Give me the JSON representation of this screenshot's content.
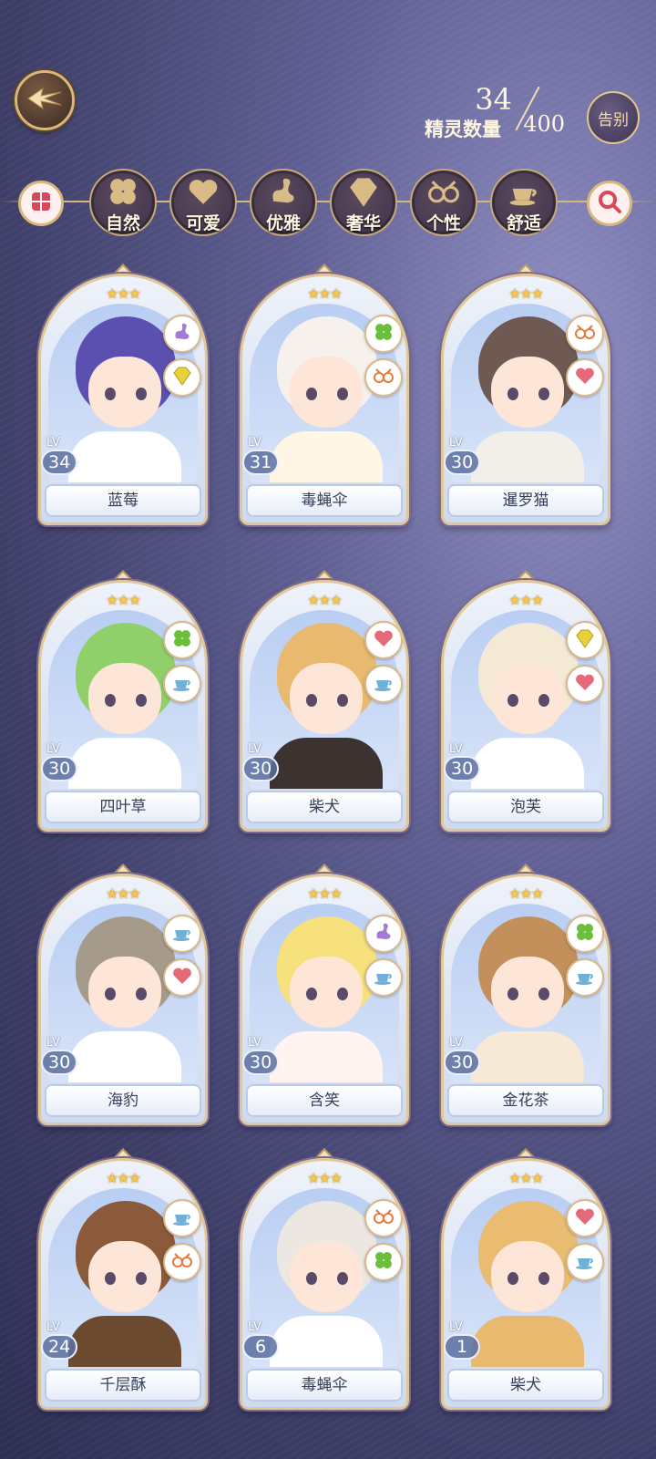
{
  "header": {
    "spirit_count_label": "精灵数量",
    "spirit_count_current": "34",
    "spirit_count_total": "400",
    "farewell_label": "告别"
  },
  "filters": [
    {
      "label": "自然",
      "icon": "clover-icon"
    },
    {
      "label": "可爱",
      "icon": "heart-icon"
    },
    {
      "label": "优雅",
      "icon": "swan-icon"
    },
    {
      "label": "奢华",
      "icon": "diamond-icon"
    },
    {
      "label": "个性",
      "icon": "glasses-icon"
    },
    {
      "label": "舒适",
      "icon": "teacup-icon"
    }
  ],
  "cards": [
    {
      "name": "蓝莓",
      "lv_tag": "LV",
      "level": "34",
      "stars": "★★★",
      "traits": [
        "swan-icon",
        "diamond-icon"
      ],
      "hair": "#5b4fb0",
      "outfit": "#ffffff"
    },
    {
      "name": "毒蝇伞",
      "lv_tag": "LV",
      "level": "31",
      "stars": "★★★",
      "traits": [
        "clover-icon",
        "glasses-icon"
      ],
      "hair": "#f6f1ec",
      "outfit": "#fff6e5"
    },
    {
      "name": "暹罗猫",
      "lv_tag": "LV",
      "level": "30",
      "stars": "★★★",
      "traits": [
        "glasses-icon",
        "heart-icon"
      ],
      "hair": "#6e5a52",
      "outfit": "#f2eee8"
    },
    {
      "name": "四叶草",
      "lv_tag": "LV",
      "level": "30",
      "stars": "★★★",
      "traits": [
        "clover-icon",
        "teacup-icon"
      ],
      "hair": "#8fd06a",
      "outfit": "#ffffff"
    },
    {
      "name": "柴犬",
      "lv_tag": "LV",
      "level": "30",
      "stars": "★★★",
      "traits": [
        "heart-icon",
        "teacup-icon"
      ],
      "hair": "#e8b96e",
      "outfit": "#3c3330"
    },
    {
      "name": "泡芙",
      "lv_tag": "LV",
      "level": "30",
      "stars": "★★★",
      "traits": [
        "diamond-icon",
        "heart-icon"
      ],
      "hair": "#f4e9d4",
      "outfit": "#ffffff"
    },
    {
      "name": "海豹",
      "lv_tag": "LV",
      "level": "30",
      "stars": "★★★",
      "traits": [
        "teacup-icon",
        "heart-icon"
      ],
      "hair": "#a69a8a",
      "outfit": "#ffffff"
    },
    {
      "name": "含笑",
      "lv_tag": "LV",
      "level": "30",
      "stars": "★★★",
      "traits": [
        "swan-icon",
        "teacup-icon"
      ],
      "hair": "#f7e17c",
      "outfit": "#fff4ef"
    },
    {
      "name": "金花茶",
      "lv_tag": "LV",
      "level": "30",
      "stars": "★★★",
      "traits": [
        "clover-icon",
        "teacup-icon"
      ],
      "hair": "#c38f5a",
      "outfit": "#f6e9d6"
    },
    {
      "name": "千层酥",
      "lv_tag": "LV",
      "level": "24",
      "stars": "★★★",
      "traits": [
        "teacup-icon",
        "glasses-icon"
      ],
      "hair": "#8a5a3a",
      "outfit": "#6b4a30"
    },
    {
      "name": "毒蝇伞",
      "lv_tag": "LV",
      "level": "6",
      "stars": "★★★",
      "traits": [
        "glasses-icon",
        "clover-icon"
      ],
      "hair": "#ece7e1",
      "outfit": "#ffffff"
    },
    {
      "name": "柴犬",
      "lv_tag": "LV",
      "level": "1",
      "stars": "★★★",
      "traits": [
        "heart-icon",
        "teacup-icon"
      ],
      "hair": "#e9bc72",
      "outfit": "#e8b96e"
    }
  ]
}
